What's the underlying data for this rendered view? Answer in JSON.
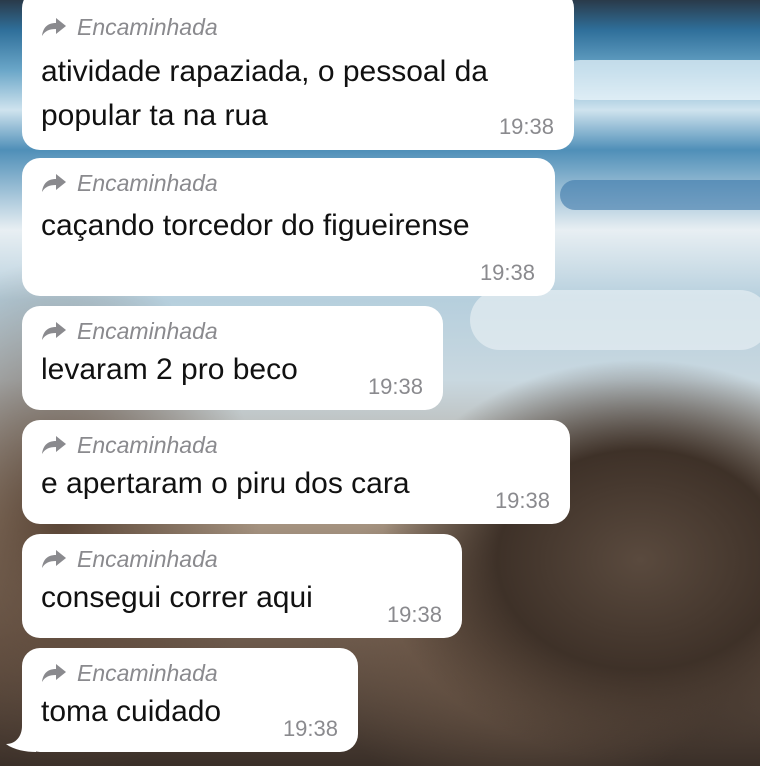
{
  "chat": {
    "forward_label": "Encaminhada",
    "messages": [
      {
        "text": "atividade rapaziada, o pessoal da popular ta na rua",
        "time": "19:38"
      },
      {
        "text": "caçando torcedor do figueirense",
        "time": "19:38"
      },
      {
        "text": "levaram 2 pro beco",
        "time": "19:38"
      },
      {
        "text": "e apertaram o piru dos cara",
        "time": "19:38"
      },
      {
        "text": "consegui correr aqui",
        "time": "19:38"
      },
      {
        "text": "toma cuidado",
        "time": "19:38"
      }
    ]
  },
  "icons": {
    "forward": "forward-arrow-icon"
  },
  "colors": {
    "bubble": "#ffffff",
    "meta": "#8a8a8e",
    "text": "#111111"
  }
}
